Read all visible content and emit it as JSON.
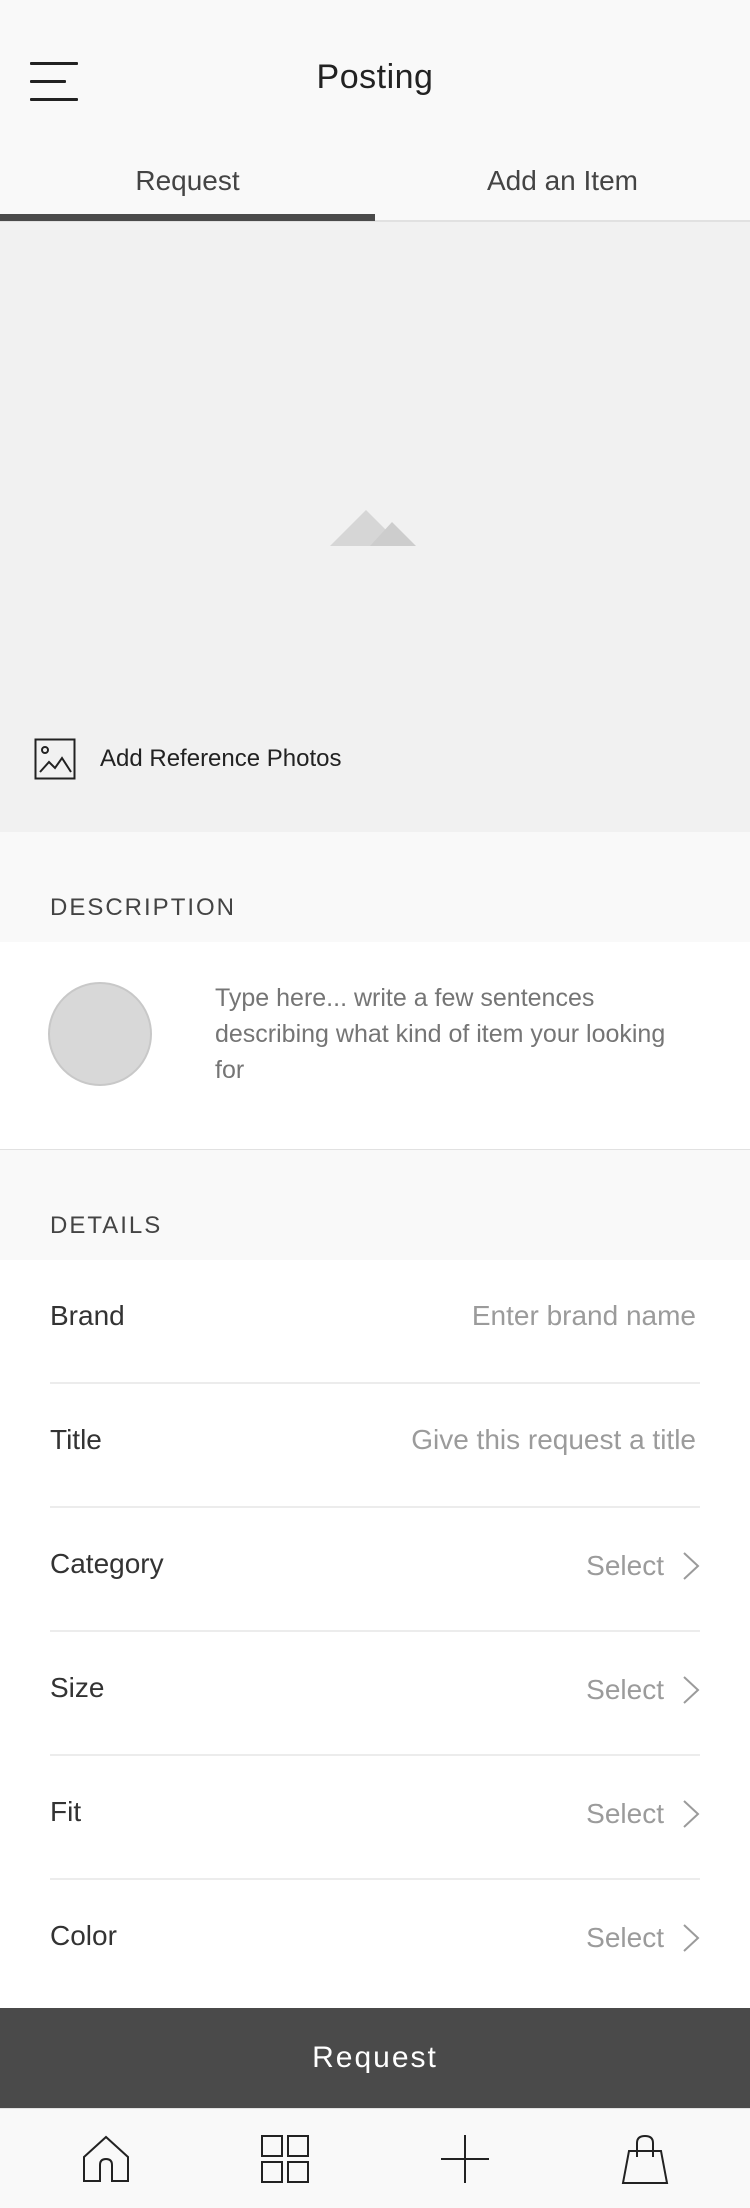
{
  "header": {
    "title": "Posting",
    "menu_icon": "hamburger-menu-icon"
  },
  "tabs": [
    {
      "label": "Request",
      "active": true
    },
    {
      "label": "Add an Item",
      "active": false
    }
  ],
  "photos": {
    "placeholder_icon": "mountain-placeholder-icon",
    "add_label": "Add Reference Photos",
    "add_icon": "picture-icon"
  },
  "description": {
    "section_title": "DESCRIPTION",
    "placeholder": "Type here... write a few sentences describing what kind of item your looking for"
  },
  "details": {
    "section_title": "DETAILS",
    "rows": [
      {
        "label": "Brand",
        "type": "input",
        "placeholder": "Enter brand name"
      },
      {
        "label": "Title",
        "type": "input",
        "placeholder": "Give this request a title"
      },
      {
        "label": "Category",
        "type": "select",
        "value": "Select"
      },
      {
        "label": "Size",
        "type": "select",
        "value": "Select"
      },
      {
        "label": "Fit",
        "type": "select",
        "value": "Select"
      },
      {
        "label": "Color",
        "type": "select",
        "value": "Select"
      }
    ]
  },
  "action": {
    "request_label": "Request"
  },
  "bottom_nav": [
    {
      "icon": "home-icon"
    },
    {
      "icon": "grid-icon"
    },
    {
      "icon": "plus-icon"
    },
    {
      "icon": "shopping-bag-icon"
    }
  ],
  "colors": {
    "accent": "#4a4a4a",
    "background": "#f9f9f9",
    "photo_area": "#f1f1f1",
    "placeholder_text": "#9b9b9b"
  }
}
